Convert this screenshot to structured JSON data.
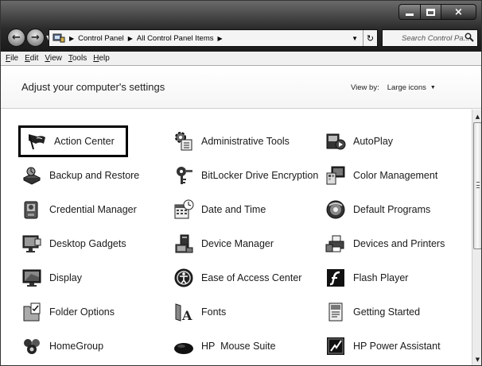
{
  "window": {
    "caption_buttons": {
      "minimize": "minimize-icon",
      "maximize": "maximize-icon",
      "close": "×"
    }
  },
  "address_bar": {
    "crumbs": [
      "Control Panel",
      "All Control Panel Items"
    ],
    "search_placeholder": "Search Control Pa..."
  },
  "menu": {
    "items": [
      {
        "key": "F",
        "rest": "ile"
      },
      {
        "key": "E",
        "rest": "dit"
      },
      {
        "key": "V",
        "rest": "iew"
      },
      {
        "key": "T",
        "rest": "ools"
      },
      {
        "key": "H",
        "rest": "elp"
      }
    ]
  },
  "header": {
    "title": "Adjust your computer's settings",
    "view_by_label": "View by:",
    "view_by_value": "Large icons"
  },
  "items": [
    {
      "label": "Action Center",
      "icon": "flag-icon",
      "selected": true
    },
    {
      "label": "Administrative Tools",
      "icon": "admin-tools-icon"
    },
    {
      "label": "AutoPlay",
      "icon": "autoplay-icon"
    },
    {
      "label": "Backup and Restore",
      "icon": "backup-icon"
    },
    {
      "label": "BitLocker Drive Encryption",
      "icon": "key-icon"
    },
    {
      "label": "Color Management",
      "icon": "color-management-icon"
    },
    {
      "label": "Credential Manager",
      "icon": "credential-icon"
    },
    {
      "label": "Date and Time",
      "icon": "calendar-clock-icon"
    },
    {
      "label": "Default Programs",
      "icon": "default-programs-icon"
    },
    {
      "label": "Desktop Gadgets",
      "icon": "gadgets-icon"
    },
    {
      "label": "Device Manager",
      "icon": "device-manager-icon"
    },
    {
      "label": "Devices and Printers",
      "icon": "printer-icon"
    },
    {
      "label": "Display",
      "icon": "monitor-icon"
    },
    {
      "label": "Ease of Access Center",
      "icon": "ease-of-access-icon"
    },
    {
      "label": "Flash Player",
      "icon": "flash-icon"
    },
    {
      "label": "Folder Options",
      "icon": "folder-options-icon"
    },
    {
      "label": "Fonts",
      "icon": "fonts-icon"
    },
    {
      "label": "Getting Started",
      "icon": "getting-started-icon"
    },
    {
      "label": "HomeGroup",
      "icon": "homegroup-icon"
    },
    {
      "label": "HP  Mouse Suite",
      "icon": "mouse-icon"
    },
    {
      "label": "HP Power Assistant",
      "icon": "power-assistant-icon"
    }
  ]
}
